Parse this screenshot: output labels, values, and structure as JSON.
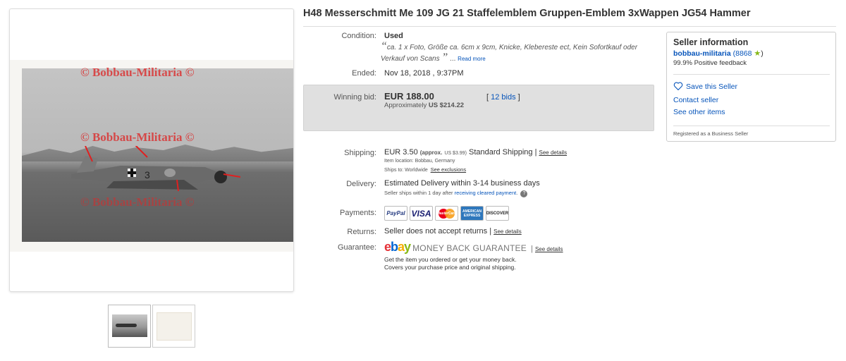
{
  "title": "H48 Messerschmitt Me 109 JG 21 Staffelemblem Gruppen-Emblem 3xWappen JG54 Hammer",
  "gallery": {
    "watermark": "© Bobbau-Militaria ©",
    "tail_number": "3"
  },
  "condition": {
    "label": "Condition:",
    "value": "Used",
    "description": "ca. 1 x Foto, Größe ca. 6cm x 9cm, Knicke, Klebereste ect, Kein Sofortkauf oder Verkauf von Scans",
    "ellipsis": " ...",
    "read_more": "Read more"
  },
  "ended": {
    "label": "Ended:",
    "value": "Nov 18, 2018 , 9:37PM"
  },
  "bid": {
    "label": "Winning bid:",
    "price": "EUR 188.00",
    "approx_label": "Approximately",
    "approx_value": "US $214.22",
    "bids_open": "[ ",
    "bids_link": "12 bids",
    "bids_close": " ]"
  },
  "shipping": {
    "label": "Shipping:",
    "price": "EUR 3.50",
    "approx": "(approx.",
    "approx_value": "US $3.99)",
    "method": "Standard Shipping",
    "sep": "|",
    "see_details": "See details",
    "item_location": "Item location:  Bobbau, Germany",
    "ships_to": "Ships to:  Worldwide",
    "see_exclusions": "See exclusions"
  },
  "delivery": {
    "label": "Delivery:",
    "value": "Estimated Delivery within 3-14 business days",
    "note_prefix": "Seller ships within 1 day after",
    "note_link": "receiving cleared payment",
    "note_suffix": "."
  },
  "payments": {
    "label": "Payments:",
    "paypal": "PayPal",
    "visa": "VISA",
    "mastercard": "MasterCard",
    "amex": "AMERICAN EXPRESS",
    "discover": "DISCOVER"
  },
  "returns": {
    "label": "Returns:",
    "value": "Seller does not accept returns",
    "sep": "|",
    "see_details": "See details"
  },
  "guarantee": {
    "label": "Guarantee:",
    "logo": {
      "e": "e",
      "b": "b",
      "a": "a",
      "y": "y"
    },
    "mbg": "MONEY BACK GUARANTEE",
    "sep": "|",
    "see_details": "See details",
    "line1": "Get the item you ordered or get your money back.",
    "line2": "Covers your purchase price and original shipping."
  },
  "seller": {
    "title": "Seller information",
    "name": "bobbau-militaria",
    "feedback_count": "(8868",
    "feedback_close": ")",
    "positive": "99.9% Positive feedback",
    "save": "Save this Seller",
    "contact": "Contact seller",
    "other_items": "See other items",
    "business": "Registered as a Business Seller"
  },
  "colors": {
    "link": "#0654ba",
    "star": "#86b817",
    "watermark": "#dc2828"
  }
}
